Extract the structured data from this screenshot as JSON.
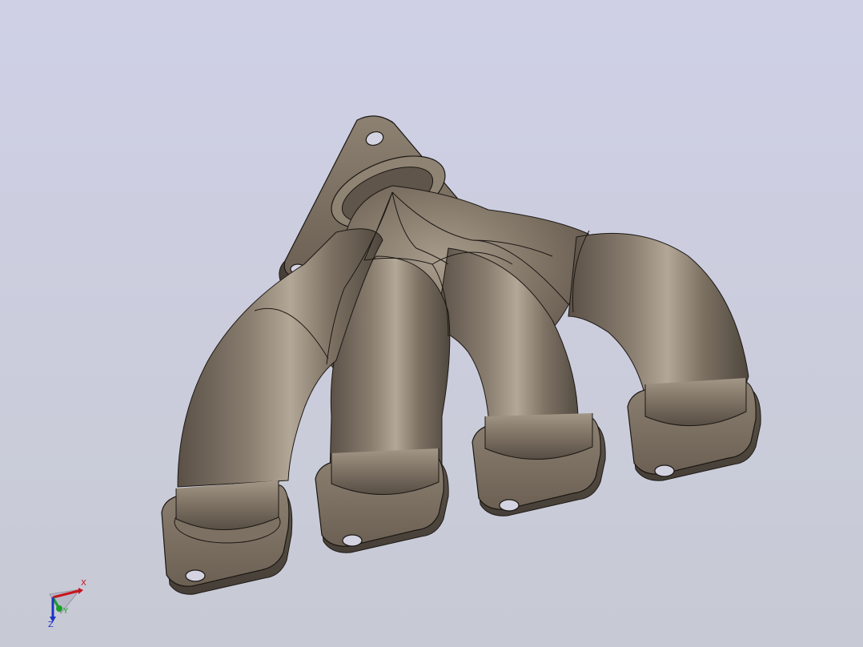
{
  "viewport": {
    "background_top": "#cfd0e6",
    "background_bottom": "#c7cad4",
    "model_color": "#7a6e60",
    "model_highlight": "#b6aa9c",
    "model_shadow": "#4e463d",
    "edge_color": "#1c1814",
    "hole_color": "#d4d3e2"
  },
  "triad": {
    "x_label": "X",
    "y_label": "Y",
    "z_label": "Z",
    "x_color": "#c8141e",
    "y_color": "#1aa028",
    "z_color": "#1e32c8"
  }
}
